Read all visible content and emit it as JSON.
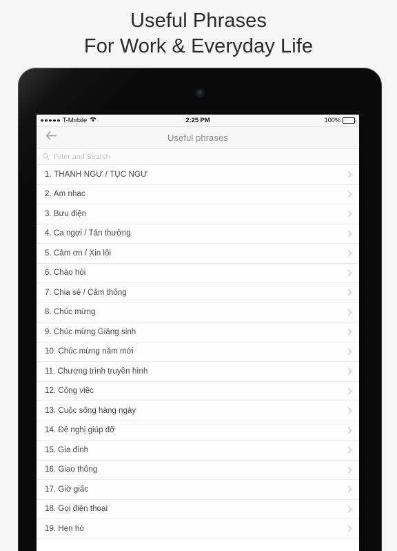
{
  "promo": {
    "line1": "Useful Phrases",
    "line2": "For Work & Everyday Life"
  },
  "device": {
    "type": "tablet",
    "bezel_color": "#0a0a0a",
    "camera_icon": "front-camera"
  },
  "status_bar": {
    "signal_dots": 5,
    "carrier": "T-Mobile",
    "wifi_icon": "wifi-icon",
    "time": "2:25 PM",
    "battery_percent": "100%",
    "battery_icon": "battery-full-icon"
  },
  "nav_bar": {
    "back_icon": "arrow-left-icon",
    "title": "Useful phrases"
  },
  "search": {
    "icon": "search-icon",
    "placeholder": "Filter and Search",
    "value": ""
  },
  "list": {
    "disclosure_icon": "chevron-right-icon",
    "items": [
      {
        "label": "1. THÀNH NGỮ / TỤC NGỮ",
        "caps": true
      },
      {
        "label": "2. Âm nhạc",
        "caps": false
      },
      {
        "label": "3. Bưu điện",
        "caps": false
      },
      {
        "label": "4. Ca ngợi / Tán thưởng",
        "caps": false
      },
      {
        "label": "5. Cảm ơn / Xin lỗi",
        "caps": false
      },
      {
        "label": "6. Chào hỏi",
        "caps": false
      },
      {
        "label": "7. Chia sẻ / Cảm thông",
        "caps": false
      },
      {
        "label": "8. Chúc mừng",
        "caps": false
      },
      {
        "label": "9. Chúc mừng Giáng sinh",
        "caps": false
      },
      {
        "label": "10. Chúc mừng năm mới",
        "caps": false
      },
      {
        "label": "11. Chương trình truyền hình",
        "caps": false
      },
      {
        "label": "12. Công việc",
        "caps": false
      },
      {
        "label": "13. Cuộc sống hàng ngày",
        "caps": false
      },
      {
        "label": "14. Đề nghị giúp đỡ",
        "caps": false
      },
      {
        "label": "15. Gia đình",
        "caps": false
      },
      {
        "label": "16. Giao thông",
        "caps": false
      },
      {
        "label": "17. Giờ giấc",
        "caps": false
      },
      {
        "label": "18. Gọi điện thoại",
        "caps": false
      },
      {
        "label": "19. Hẹn hò",
        "caps": false
      }
    ]
  },
  "colors": {
    "page_background": "#f6f6f6",
    "bezel": "#0a0a0a",
    "chrome": "#f7f7f7",
    "text_primary": "#444444",
    "text_muted": "#8e8e8e",
    "separator": "#ededed",
    "placeholder": "#c2c2c2"
  }
}
